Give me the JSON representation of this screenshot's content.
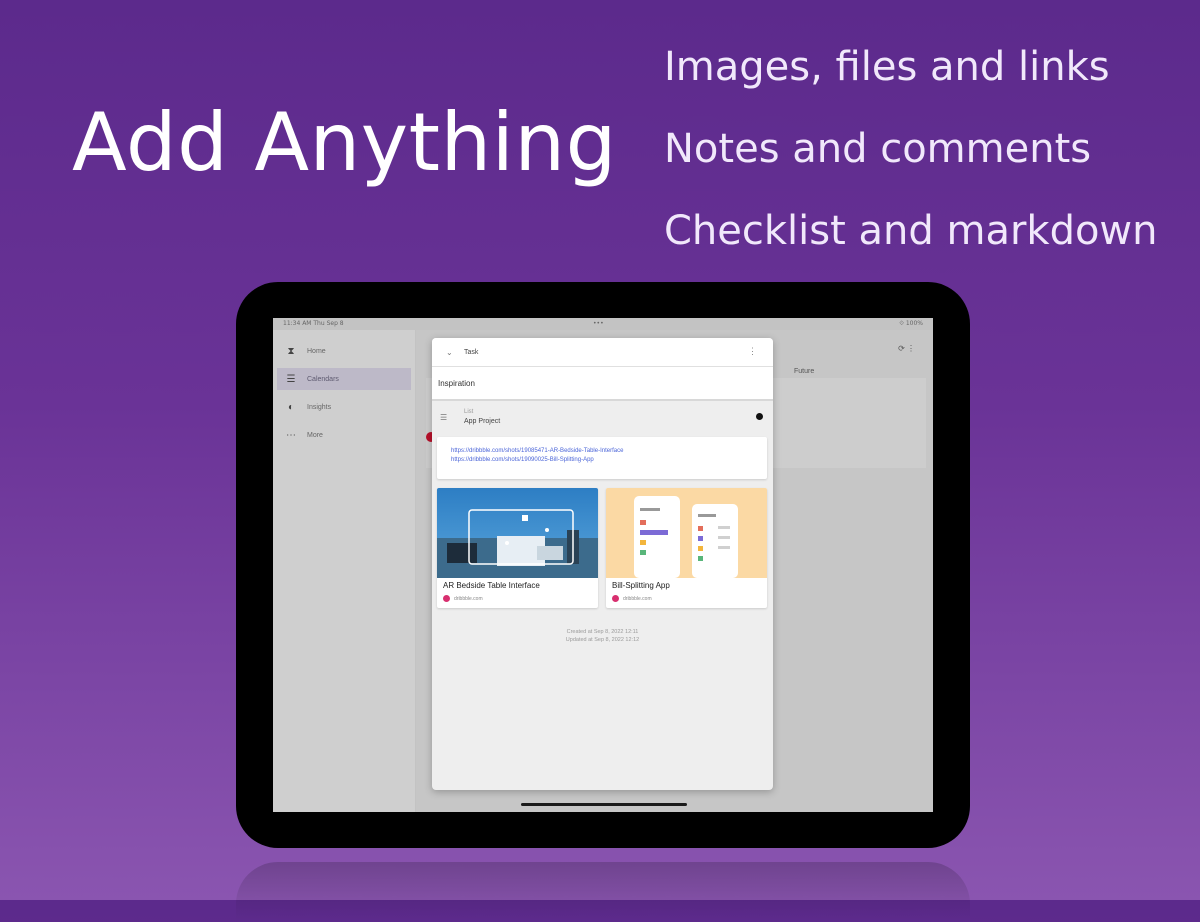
{
  "headline": "Add Anything",
  "features": [
    "Images, files and links",
    "Notes and comments",
    "Checklist and markdown"
  ],
  "statusbar": {
    "time": "11:34 AM  Thu Sep 8",
    "center": "•••",
    "right": "⟐ 100%"
  },
  "sidebar": {
    "items": [
      {
        "label": "Home",
        "icon": "hourglass-icon",
        "active": false
      },
      {
        "label": "Calendars",
        "icon": "list-icon",
        "active": true
      },
      {
        "label": "Insights",
        "icon": "pie-chart-icon",
        "active": false
      },
      {
        "label": "More",
        "icon": "more-icon",
        "active": false
      }
    ]
  },
  "main": {
    "future_label": "Future"
  },
  "modal": {
    "header_label": "Task",
    "title": "Inspiration",
    "list_key": "List",
    "list_value": "App Project",
    "links": [
      "https://dribbble.com/shots/19085471-AR-Bedside-Table-Interface",
      "https://dribbble.com/shots/19090025-Bill-Splitting-App"
    ],
    "cards": [
      {
        "caption": "AR Bedside Table Interface",
        "source": "dribbble.com"
      },
      {
        "caption": "Bill-Splitting App",
        "source": "dribbble.com"
      }
    ],
    "created": "Created at Sep 8, 2022 12:11",
    "updated": "Updated at Sep 8, 2022 12:12"
  },
  "colors": {
    "accent": "#5c2a8c",
    "link": "#4a64d8",
    "badge": "#b8102a"
  }
}
